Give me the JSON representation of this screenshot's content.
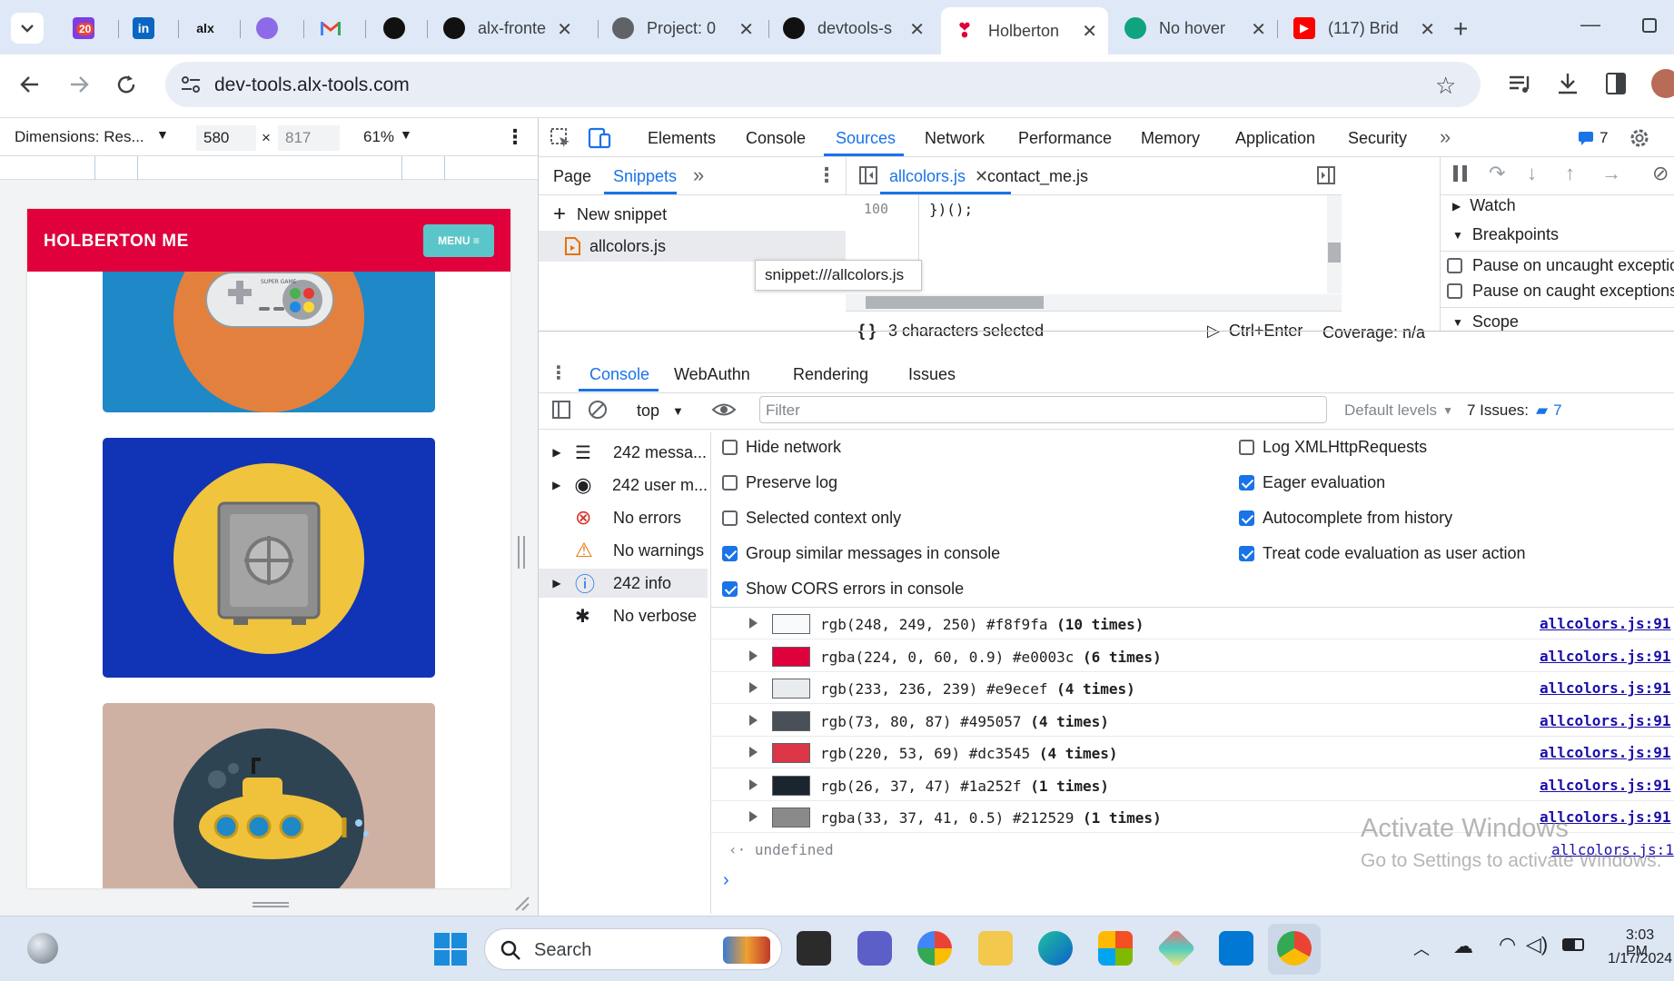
{
  "browser": {
    "tabs": [
      {
        "label": "",
        "badge": "20"
      },
      {
        "label": ""
      },
      {
        "label": ""
      },
      {
        "label": ""
      },
      {
        "label": ""
      },
      {
        "label": ""
      },
      {
        "label": "alx-fronte"
      },
      {
        "label": "Project: 0"
      },
      {
        "label": "devtools-s"
      },
      {
        "label": "Holberton"
      },
      {
        "label": "No hover"
      },
      {
        "label": "(117) Brid"
      }
    ],
    "url": "dev-tools.alx-tools.com"
  },
  "device_toolbar": {
    "dimensions_label": "Dimensions: Res...",
    "width": "580",
    "times": "×",
    "height": "817",
    "zoom": "61%"
  },
  "page": {
    "brand": "HOLBERTON ME",
    "menu_label": "MENU ≡",
    "console_label": "SUPER GAME"
  },
  "devtools": {
    "main_tabs": [
      "Elements",
      "Console",
      "Sources",
      "Network",
      "Performance",
      "Memory",
      "Application",
      "Security"
    ],
    "issues_count": "7",
    "nav_tabs": [
      "Page",
      "Snippets"
    ],
    "new_snippet": "New snippet",
    "snippet_file": "allcolors.js",
    "tooltip": "snippet:///allcolors.js",
    "editor_tabs": [
      "allcolors.js",
      "contact_me.js"
    ],
    "line_number": "100",
    "code_line": "})();",
    "status_selected": "3 characters selected",
    "run_shortcut": "Ctrl+Enter",
    "coverage": "Coverage: n/a",
    "debugger": {
      "watch": "Watch",
      "breakpoints": "Breakpoints",
      "pause_uncaught": "Pause on uncaught exceptio",
      "pause_caught": "Pause on caught exceptions",
      "scope": "Scope"
    },
    "drawer_tabs": [
      "Console",
      "WebAuthn",
      "Rendering",
      "Issues"
    ],
    "context": "top",
    "filter_placeholder": "Filter",
    "levels": "Default levels",
    "issues_label": "7 Issues:",
    "issues_badge": "7",
    "sidebar": [
      {
        "label": "242 messa...",
        "icon": "list-icon"
      },
      {
        "label": "242 user m...",
        "icon": "user-icon"
      },
      {
        "label": "No errors",
        "icon": "error-icon"
      },
      {
        "label": "No warnings",
        "icon": "warning-icon"
      },
      {
        "label": "242 info",
        "icon": "info-icon"
      },
      {
        "label": "No verbose",
        "icon": "bug-icon"
      }
    ],
    "settings_left": [
      {
        "label": "Hide network",
        "checked": false
      },
      {
        "label": "Preserve log",
        "checked": false
      },
      {
        "label": "Selected context only",
        "checked": false
      },
      {
        "label": "Group similar messages in console",
        "checked": true
      },
      {
        "label": "Show CORS errors in console",
        "checked": true
      }
    ],
    "settings_right": [
      {
        "label": "Log XMLHttpRequests",
        "checked": false
      },
      {
        "label": "Eager evaluation",
        "checked": true
      },
      {
        "label": "Autocomplete from history",
        "checked": true
      },
      {
        "label": "Treat code evaluation as user action",
        "checked": true
      }
    ],
    "logs": [
      {
        "color": "#f8f9fa",
        "text": "rgb(248, 249, 250) #f8f9fa",
        "count": "(10 times)",
        "source": "allcolors.js:91"
      },
      {
        "color": "#e0003c",
        "text": "rgba(224, 0, 60, 0.9) #e0003c",
        "count": "(6 times)",
        "source": "allcolors.js:91"
      },
      {
        "color": "#e9ecef",
        "text": "rgb(233, 236, 239) #e9ecef",
        "count": "(4 times)",
        "source": "allcolors.js:91"
      },
      {
        "color": "#495057",
        "text": "rgb(73, 80, 87) #495057",
        "count": "(4 times)",
        "source": "allcolors.js:91"
      },
      {
        "color": "#dc3545",
        "text": "rgb(220, 53, 69) #dc3545",
        "count": "(4 times)",
        "source": "allcolors.js:91"
      },
      {
        "color": "#1a252f",
        "text": "rgb(26, 37, 47) #1a252f",
        "count": "(1 times)",
        "source": "allcolors.js:91"
      },
      {
        "color": "#8a8a8a",
        "text": "rgba(33, 37, 41, 0.5) #212529",
        "count": "(1 times)",
        "source": "allcolors.js:91"
      }
    ],
    "result": "undefined",
    "result_source": "allcolors.js:1",
    "watermark_title": "Activate Windows",
    "watermark_sub": "Go to Settings to activate Windows."
  },
  "taskbar": {
    "search_placeholder": "Search",
    "time": "3:03 PM",
    "date": "1/17/2024"
  }
}
